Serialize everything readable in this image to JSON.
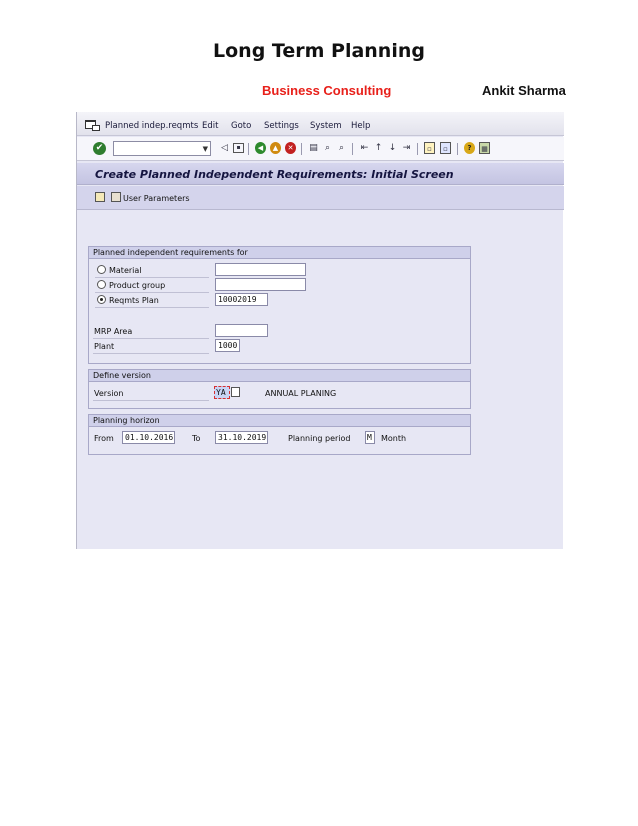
{
  "document": {
    "title": "Long Term Planning",
    "subtitle_left": "Business Consulting",
    "subtitle_right": "Ankit Sharma"
  },
  "menu": {
    "items": [
      "Planned indep.reqmts",
      "Edit",
      "Goto",
      "Settings",
      "System",
      "Help"
    ]
  },
  "toolbar": {
    "command_value": ""
  },
  "screen": {
    "title": "Create Planned Independent Requirements: Initial Screen",
    "app_button": "User Parameters"
  },
  "group_for": {
    "header": "Planned independent requirements for",
    "material_label": "Material",
    "material_value": "",
    "product_group_label": "Product group",
    "product_group_value": "",
    "reqmts_plan_label": "Reqmts Plan",
    "reqmts_plan_value": "10002019",
    "mrp_area_label": "MRP Area",
    "mrp_area_value": "",
    "plant_label": "Plant",
    "plant_value": "1000",
    "selected": "Reqmts Plan"
  },
  "group_version": {
    "header": "Define version",
    "version_label": "Version",
    "version_value": "YA",
    "version_text": "ANNUAL PLANING"
  },
  "group_horizon": {
    "header": "Planning horizon",
    "from_label": "From",
    "from_value": "01.10.2016",
    "to_label": "To",
    "to_value": "31.10.2019",
    "period_label": "Planning period",
    "period_value": "M",
    "period_text": "Month"
  },
  "colors": {
    "subtitle_accent": "#e8201a",
    "sap_background": "#e7e7f4",
    "title_bar": "#c4c4e2"
  }
}
